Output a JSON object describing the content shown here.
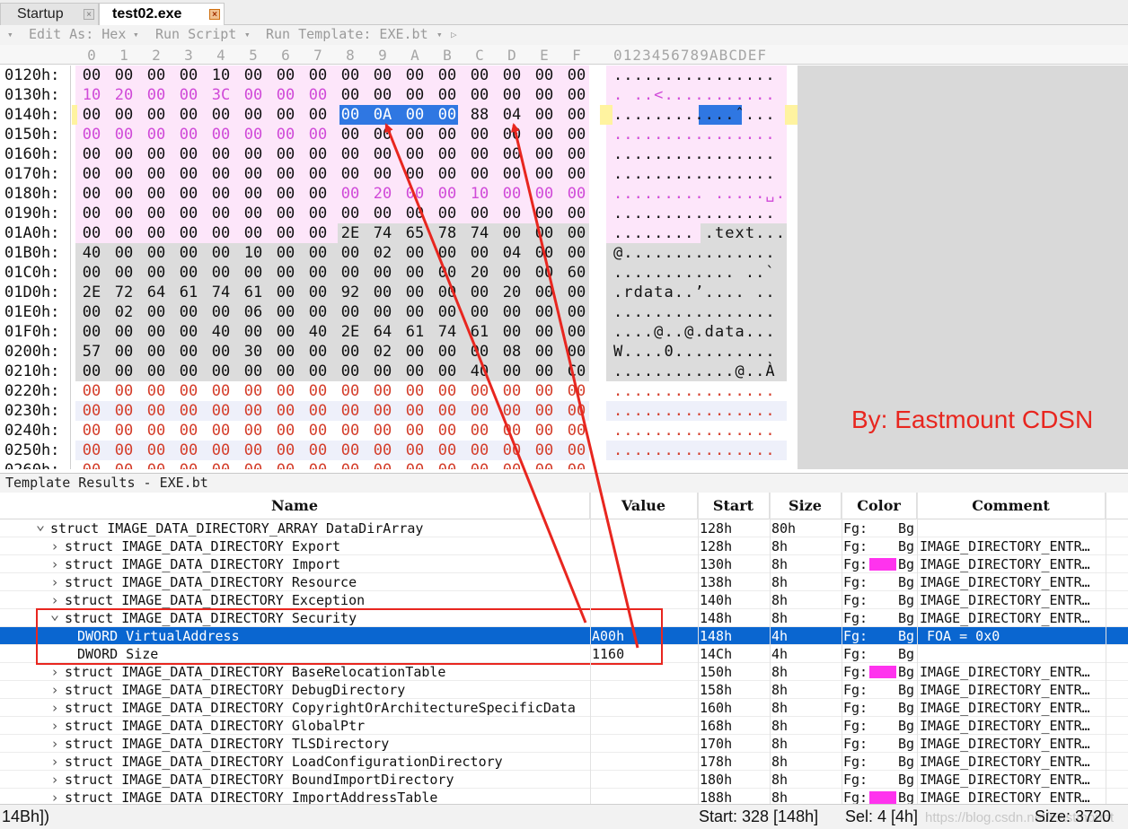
{
  "tabs": [
    {
      "label": "Startup"
    },
    {
      "label": "test02.exe"
    }
  ],
  "editor_toolbar": {
    "edit_as": "Edit As: Hex",
    "run_script": "Run Script",
    "run_template": "Run Template: EXE.bt"
  },
  "hex_header": {
    "columns": [
      "0",
      "1",
      "2",
      "3",
      "4",
      "5",
      "6",
      "7",
      "8",
      "9",
      "A",
      "B",
      "C",
      "D",
      "E",
      "F"
    ],
    "ascii": "0123456789ABCDEF"
  },
  "hex_rows": [
    {
      "addr": "0120h:",
      "bytes": [
        "00",
        "00",
        "00",
        "00",
        "10",
        "00",
        "00",
        "00",
        "00",
        "00",
        "00",
        "00",
        "00",
        "00",
        "00",
        "00"
      ],
      "ascii": "................"
    },
    {
      "addr": "0130h:",
      "bytes": [
        "10",
        "20",
        "00",
        "00",
        "3C",
        "00",
        "00",
        "00",
        "00",
        "00",
        "00",
        "00",
        "00",
        "00",
        "00",
        "00"
      ],
      "ascii": ". ..<..........."
    },
    {
      "addr": "0140h:",
      "bytes": [
        "00",
        "00",
        "00",
        "00",
        "00",
        "00",
        "00",
        "00",
        "00",
        "0A",
        "00",
        "00",
        "88",
        "04",
        "00",
        "00"
      ],
      "ascii": "............ˆ..."
    },
    {
      "addr": "0150h:",
      "bytes": [
        "00",
        "00",
        "00",
        "00",
        "00",
        "00",
        "00",
        "00",
        "00",
        "00",
        "00",
        "00",
        "00",
        "00",
        "00",
        "00"
      ],
      "ascii": "................"
    },
    {
      "addr": "0160h:",
      "bytes": [
        "00",
        "00",
        "00",
        "00",
        "00",
        "00",
        "00",
        "00",
        "00",
        "00",
        "00",
        "00",
        "00",
        "00",
        "00",
        "00"
      ],
      "ascii": "................"
    },
    {
      "addr": "0170h:",
      "bytes": [
        "00",
        "00",
        "00",
        "00",
        "00",
        "00",
        "00",
        "00",
        "00",
        "00",
        "00",
        "00",
        "00",
        "00",
        "00",
        "00"
      ],
      "ascii": "................"
    },
    {
      "addr": "0180h:",
      "bytes": [
        "00",
        "00",
        "00",
        "00",
        "00",
        "00",
        "00",
        "00",
        "00",
        "20",
        "00",
        "00",
        "10",
        "00",
        "00",
        "00"
      ],
      "ascii": "......... .....␣."
    },
    {
      "addr": "0190h:",
      "bytes": [
        "00",
        "00",
        "00",
        "00",
        "00",
        "00",
        "00",
        "00",
        "00",
        "00",
        "00",
        "00",
        "00",
        "00",
        "00",
        "00"
      ],
      "ascii": "................"
    },
    {
      "addr": "01A0h:",
      "bytes": [
        "00",
        "00",
        "00",
        "00",
        "00",
        "00",
        "00",
        "00",
        "2E",
        "74",
        "65",
        "78",
        "74",
        "00",
        "00",
        "00"
      ],
      "ascii": "........ .text..."
    },
    {
      "addr": "01B0h:",
      "bytes": [
        "40",
        "00",
        "00",
        "00",
        "00",
        "10",
        "00",
        "00",
        "00",
        "02",
        "00",
        "00",
        "00",
        "04",
        "00",
        "00"
      ],
      "ascii": "@..............."
    },
    {
      "addr": "01C0h:",
      "bytes": [
        "00",
        "00",
        "00",
        "00",
        "00",
        "00",
        "00",
        "00",
        "00",
        "00",
        "00",
        "00",
        "20",
        "00",
        "00",
        "60"
      ],
      "ascii": "............ ..`"
    },
    {
      "addr": "01D0h:",
      "bytes": [
        "2E",
        "72",
        "64",
        "61",
        "74",
        "61",
        "00",
        "00",
        "92",
        "00",
        "00",
        "00",
        "00",
        "20",
        "00",
        "00"
      ],
      "ascii": ".rdata..’.... .."
    },
    {
      "addr": "01E0h:",
      "bytes": [
        "00",
        "02",
        "00",
        "00",
        "00",
        "06",
        "00",
        "00",
        "00",
        "00",
        "00",
        "00",
        "00",
        "00",
        "00",
        "00"
      ],
      "ascii": "................"
    },
    {
      "addr": "01F0h:",
      "bytes": [
        "00",
        "00",
        "00",
        "00",
        "40",
        "00",
        "00",
        "40",
        "2E",
        "64",
        "61",
        "74",
        "61",
        "00",
        "00",
        "00"
      ],
      "ascii": "....@..@.data..."
    },
    {
      "addr": "0200h:",
      "bytes": [
        "57",
        "00",
        "00",
        "00",
        "00",
        "30",
        "00",
        "00",
        "00",
        "02",
        "00",
        "00",
        "00",
        "08",
        "00",
        "00"
      ],
      "ascii": "W....0.........."
    },
    {
      "addr": "0210h:",
      "bytes": [
        "00",
        "00",
        "00",
        "00",
        "00",
        "00",
        "00",
        "00",
        "00",
        "00",
        "00",
        "00",
        "40",
        "00",
        "00",
        "C0"
      ],
      "ascii": "............@..À"
    },
    {
      "addr": "0220h:",
      "bytes": [
        "00",
        "00",
        "00",
        "00",
        "00",
        "00",
        "00",
        "00",
        "00",
        "00",
        "00",
        "00",
        "00",
        "00",
        "00",
        "00"
      ],
      "ascii": "................"
    },
    {
      "addr": "0230h:",
      "bytes": [
        "00",
        "00",
        "00",
        "00",
        "00",
        "00",
        "00",
        "00",
        "00",
        "00",
        "00",
        "00",
        "00",
        "00",
        "00",
        "00"
      ],
      "ascii": "................"
    },
    {
      "addr": "0240h:",
      "bytes": [
        "00",
        "00",
        "00",
        "00",
        "00",
        "00",
        "00",
        "00",
        "00",
        "00",
        "00",
        "00",
        "00",
        "00",
        "00",
        "00"
      ],
      "ascii": "................"
    },
    {
      "addr": "0250h:",
      "bytes": [
        "00",
        "00",
        "00",
        "00",
        "00",
        "00",
        "00",
        "00",
        "00",
        "00",
        "00",
        "00",
        "00",
        "00",
        "00",
        "00"
      ],
      "ascii": "................"
    },
    {
      "addr": "0260h:",
      "bytes": [
        "00",
        "00",
        "00",
        "00",
        "00",
        "00",
        "00",
        "00",
        "00",
        "00",
        "00",
        "00",
        "00",
        "00",
        "00",
        "00"
      ],
      "ascii": "................"
    }
  ],
  "colors": {
    "pink_bg": "#fde6fa",
    "gray_bg": "#dcdcdc",
    "selection": "#2f77e2",
    "magenta_text": "#d04ad8",
    "red_text": "#d43d2a",
    "swatch": "#ff33ee",
    "annotation_red": "#e8261f"
  },
  "watermark": "By:  Eastmount CDSN",
  "template_results": {
    "title": "Template Results - EXE.bt",
    "columns": {
      "name": "Name",
      "value": "Value",
      "start": "Start",
      "size": "Size",
      "color": "Color",
      "comment": "Comment"
    },
    "rows": [
      {
        "name": "struct IMAGE_DATA_DIRECTORY_ARRAY DataDirArray",
        "value": "",
        "start": "128h",
        "size": "80h",
        "fg": "Fg:",
        "bg": "Bg",
        "comment": ""
      },
      {
        "name": "struct IMAGE_DATA_DIRECTORY Export",
        "value": "",
        "start": "128h",
        "size": "8h",
        "fg": "Fg:",
        "bg": "Bg",
        "comment": "IMAGE_DIRECTORY_ENTR…"
      },
      {
        "name": "struct IMAGE_DATA_DIRECTORY Import",
        "value": "",
        "start": "130h",
        "size": "8h",
        "fg": "Fg:",
        "bg": "Bg",
        "comment": "IMAGE_DIRECTORY_ENTR…"
      },
      {
        "name": "struct IMAGE_DATA_DIRECTORY Resource",
        "value": "",
        "start": "138h",
        "size": "8h",
        "fg": "Fg:",
        "bg": "Bg",
        "comment": "IMAGE_DIRECTORY_ENTR…"
      },
      {
        "name": "struct IMAGE_DATA_DIRECTORY Exception",
        "value": "",
        "start": "140h",
        "size": "8h",
        "fg": "Fg:",
        "bg": "Bg",
        "comment": "IMAGE_DIRECTORY_ENTR…"
      },
      {
        "name": "struct IMAGE_DATA_DIRECTORY Security",
        "value": "",
        "start": "148h",
        "size": "8h",
        "fg": "Fg:",
        "bg": "Bg",
        "comment": "IMAGE_DIRECTORY_ENTR…"
      },
      {
        "name": "DWORD VirtualAddress",
        "value": "A00h",
        "start": "148h",
        "size": "4h",
        "fg": "Fg:",
        "bg": "Bg",
        "comment": "FOA = 0x0"
      },
      {
        "name": "DWORD Size",
        "value": "1160",
        "start": "14Ch",
        "size": "4h",
        "fg": "Fg:",
        "bg": "Bg",
        "comment": ""
      },
      {
        "name": "struct IMAGE_DATA_DIRECTORY BaseRelocationTable",
        "value": "",
        "start": "150h",
        "size": "8h",
        "fg": "Fg:",
        "bg": "Bg",
        "comment": "IMAGE_DIRECTORY_ENTR…"
      },
      {
        "name": "struct IMAGE_DATA_DIRECTORY DebugDirectory",
        "value": "",
        "start": "158h",
        "size": "8h",
        "fg": "Fg:",
        "bg": "Bg",
        "comment": "IMAGE_DIRECTORY_ENTR…"
      },
      {
        "name": "struct IMAGE_DATA_DIRECTORY CopyrightOrArchitectureSpecificData",
        "value": "",
        "start": "160h",
        "size": "8h",
        "fg": "Fg:",
        "bg": "Bg",
        "comment": "IMAGE_DIRECTORY_ENTR…"
      },
      {
        "name": "struct IMAGE_DATA_DIRECTORY GlobalPtr",
        "value": "",
        "start": "168h",
        "size": "8h",
        "fg": "Fg:",
        "bg": "Bg",
        "comment": "IMAGE_DIRECTORY_ENTR…"
      },
      {
        "name": "struct IMAGE_DATA_DIRECTORY TLSDirectory",
        "value": "",
        "start": "170h",
        "size": "8h",
        "fg": "Fg:",
        "bg": "Bg",
        "comment": "IMAGE_DIRECTORY_ENTR…"
      },
      {
        "name": "struct IMAGE_DATA_DIRECTORY LoadConfigurationDirectory",
        "value": "",
        "start": "178h",
        "size": "8h",
        "fg": "Fg:",
        "bg": "Bg",
        "comment": "IMAGE_DIRECTORY_ENTR…"
      },
      {
        "name": "struct IMAGE_DATA_DIRECTORY BoundImportDirectory",
        "value": "",
        "start": "180h",
        "size": "8h",
        "fg": "Fg:",
        "bg": "Bg",
        "comment": "IMAGE_DIRECTORY_ENTR…"
      },
      {
        "name": "struct IMAGE_DATA_DIRECTORY ImportAddressTable",
        "value": "",
        "start": "188h",
        "size": "8h",
        "fg": "Fg:",
        "bg": "Bg",
        "comment": "IMAGE_DIRECTORY_ENTR…"
      }
    ]
  },
  "status": {
    "left": "14Bh])",
    "start": "Start: 328 [148h]",
    "sel": "Sel: 4 [4h]",
    "size": "Size: 3720",
    "watermark": "https://blog.csdn.net/Eastmount"
  }
}
